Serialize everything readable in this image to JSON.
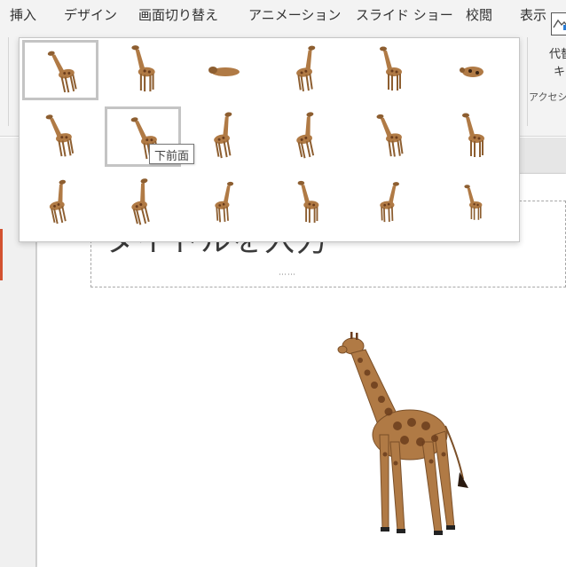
{
  "ribbon_tabs": [
    "挿入",
    "デザイン",
    "画面切り替え",
    "アニメーション",
    "スライド ショー",
    "校閲",
    "表示"
  ],
  "ribbon": {
    "alt_text_label_1": "代替",
    "alt_text_label_2": "キ",
    "accessibility_group": "アクセシ"
  },
  "slide": {
    "title_placeholder": "タイトルを入力"
  },
  "model_views_gallery": {
    "tooltip": "下前面",
    "selected_index": 0,
    "hovered_index": 7,
    "rows": 3,
    "columns": 6
  },
  "colors": {
    "accent": "#d35230",
    "giraffe_body": "#b07a45",
    "giraffe_spots": "#6b3d1d"
  }
}
